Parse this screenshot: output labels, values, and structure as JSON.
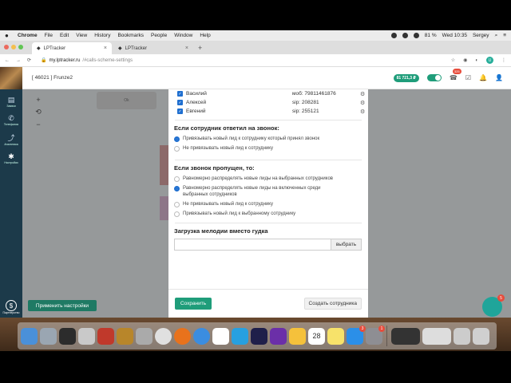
{
  "menubar": {
    "app": "Chrome",
    "items": [
      "File",
      "Edit",
      "View",
      "History",
      "Bookmarks",
      "People",
      "Window",
      "Help"
    ],
    "battery": "81 %",
    "clock": "Wed 10:35",
    "user": "Sergey"
  },
  "tabs": [
    {
      "label": "LPTracker",
      "active": true
    },
    {
      "label": "LPTracker",
      "active": false
    }
  ],
  "address": {
    "host": "my.lptracker.ru",
    "path": "/#calls-scheme-settings"
  },
  "profile_initial": "U",
  "header": {
    "account": "[ 46021 ] Frunze2",
    "balance": "81 721,3 ₽",
    "notif_count": "325"
  },
  "sidebar": {
    "items": [
      {
        "label": "Заявки",
        "icon": "leads-icon"
      },
      {
        "label": "Телефония",
        "icon": "phone-icon"
      },
      {
        "label": "Аналитика",
        "icon": "analytics-icon"
      },
      {
        "label": "Настройки",
        "icon": "settings-icon"
      }
    ],
    "bottom_label": "Партнерство",
    "bottom_glyph": "$"
  },
  "canvas": {
    "node_label": "Ok",
    "apply_button": "Применить настройки",
    "chat_badge": "5"
  },
  "modal": {
    "employees": [
      {
        "name": "Василий",
        "phone": "моб: 79811461876"
      },
      {
        "name": "Алексей",
        "phone": "sip: 208281"
      },
      {
        "name": "Евгений",
        "phone": "sip: 255121"
      }
    ],
    "answered_title": "Если сотрудник ответил на звонок:",
    "answered_options": [
      {
        "label": "Привязывать новый лид к сотруднику который принял звонок",
        "selected": true
      },
      {
        "label": "Не привязывать новый лид к сотруднику",
        "selected": false
      }
    ],
    "missed_title": "Если звонок пропущен, то:",
    "missed_options": [
      {
        "label": "Равномерно распределять новые лиды на выбранных сотрудников",
        "selected": false
      },
      {
        "label": "Равномерно распределять новые лиды на включенных среди выбранных сотрудников",
        "selected": true
      },
      {
        "label": "Не привязывать новый лид к сотруднику",
        "selected": false
      },
      {
        "label": "Привязывать новый лид к выбранному сотруднику",
        "selected": false
      }
    ],
    "melody_title": "Загрузка мелодии вместо гудка",
    "file_button": "выбрать",
    "save_button": "Сохранить",
    "create_button": "Создать сотрудника"
  },
  "dock": {
    "calendar_day": "28",
    "badges": {
      "appstore": "3",
      "prefs": "1"
    }
  }
}
